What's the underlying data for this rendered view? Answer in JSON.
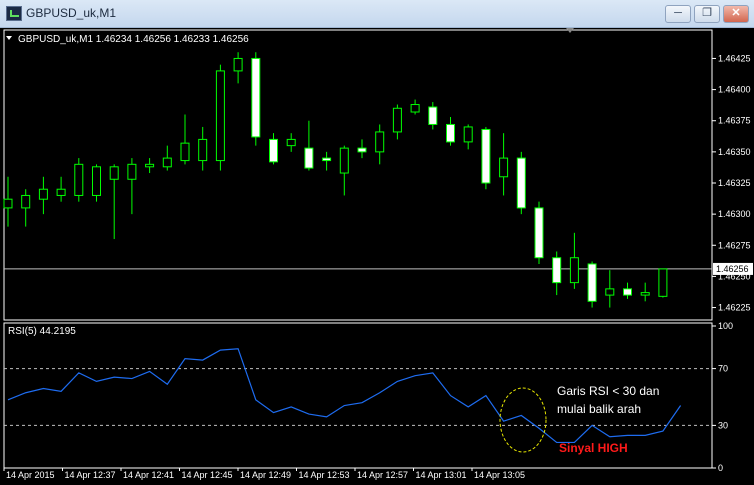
{
  "window": {
    "title": "GBPUSD_uk,M1",
    "minimize_icon": "minimize-icon",
    "restore_icon": "restore-icon",
    "close_icon": "close-icon"
  },
  "price_panel": {
    "header": "GBPUSD_uk,M1  1.46234 1.46256 1.46233 1.46256",
    "current_price": "1.46256"
  },
  "rsi_panel": {
    "header": "RSI(5) 44.2195"
  },
  "annotations": {
    "text_line1": "Garis RSI < 30 dan",
    "text_line2": "mulai balik arah",
    "signal": "Sinyal HIGH",
    "signal_color": "#ff1a1a"
  },
  "colors": {
    "background": "#000000",
    "candle_outline": "#00ff00",
    "bull_fill": "#000000",
    "bear_fill": "#ffffff",
    "rsi_line": "#1e6cf0",
    "axis_text": "#ffffff",
    "ellipse": "#e6e600"
  },
  "chart_data": [
    {
      "type": "candlestick",
      "title": "GBPUSD_uk,M1",
      "y_ticks": [
        "1.46425",
        "1.46400",
        "1.46375",
        "1.46350",
        "1.46325",
        "1.46300",
        "1.46275",
        "1.46250",
        "1.46225"
      ],
      "ylim": [
        1.46215,
        1.46435
      ],
      "current_price": 1.46256,
      "x_ticks": [
        "14 Apr 2015",
        "14 Apr 12:37",
        "14 Apr 12:41",
        "14 Apr 12:45",
        "14 Apr 12:49",
        "14 Apr 12:53",
        "14 Apr 12:57",
        "14 Apr 13:01",
        "14 Apr 13:05"
      ],
      "candles": [
        {
          "o": 1.46305,
          "h": 1.4633,
          "l": 1.4629,
          "c": 1.46312
        },
        {
          "o": 1.46305,
          "h": 1.4632,
          "l": 1.4629,
          "c": 1.46315
        },
        {
          "o": 1.46312,
          "h": 1.4633,
          "l": 1.463,
          "c": 1.4632
        },
        {
          "o": 1.46315,
          "h": 1.4633,
          "l": 1.4631,
          "c": 1.4632
        },
        {
          "o": 1.46315,
          "h": 1.46345,
          "l": 1.4631,
          "c": 1.4634
        },
        {
          "o": 1.46315,
          "h": 1.4634,
          "l": 1.4631,
          "c": 1.46338
        },
        {
          "o": 1.46328,
          "h": 1.4634,
          "l": 1.4628,
          "c": 1.46338
        },
        {
          "o": 1.46328,
          "h": 1.46345,
          "l": 1.463,
          "c": 1.4634
        },
        {
          "o": 1.46338,
          "h": 1.46345,
          "l": 1.46333,
          "c": 1.4634
        },
        {
          "o": 1.46338,
          "h": 1.46355,
          "l": 1.46335,
          "c": 1.46345
        },
        {
          "o": 1.46343,
          "h": 1.4638,
          "l": 1.4634,
          "c": 1.46357
        },
        {
          "o": 1.46343,
          "h": 1.4637,
          "l": 1.46335,
          "c": 1.4636
        },
        {
          "o": 1.46343,
          "h": 1.4642,
          "l": 1.46335,
          "c": 1.46415
        },
        {
          "o": 1.46415,
          "h": 1.4643,
          "l": 1.46405,
          "c": 1.46425
        },
        {
          "o": 1.46425,
          "h": 1.4643,
          "l": 1.46355,
          "c": 1.46362
        },
        {
          "o": 1.4636,
          "h": 1.46365,
          "l": 1.4634,
          "c": 1.46342
        },
        {
          "o": 1.46355,
          "h": 1.46365,
          "l": 1.4635,
          "c": 1.4636
        },
        {
          "o": 1.46353,
          "h": 1.46375,
          "l": 1.46335,
          "c": 1.46337
        },
        {
          "o": 1.46345,
          "h": 1.4635,
          "l": 1.46335,
          "c": 1.46343
        },
        {
          "o": 1.46333,
          "h": 1.46355,
          "l": 1.46315,
          "c": 1.46353
        },
        {
          "o": 1.46353,
          "h": 1.4636,
          "l": 1.46345,
          "c": 1.4635
        },
        {
          "o": 1.4635,
          "h": 1.46372,
          "l": 1.4634,
          "c": 1.46366
        },
        {
          "o": 1.46366,
          "h": 1.46388,
          "l": 1.4636,
          "c": 1.46385
        },
        {
          "o": 1.46382,
          "h": 1.46392,
          "l": 1.4638,
          "c": 1.46388
        },
        {
          "o": 1.46386,
          "h": 1.4639,
          "l": 1.46368,
          "c": 1.46372
        },
        {
          "o": 1.46372,
          "h": 1.46378,
          "l": 1.46355,
          "c": 1.46358
        },
        {
          "o": 1.46358,
          "h": 1.46372,
          "l": 1.46352,
          "c": 1.4637
        },
        {
          "o": 1.46368,
          "h": 1.4637,
          "l": 1.4632,
          "c": 1.46325
        },
        {
          "o": 1.4633,
          "h": 1.46365,
          "l": 1.46315,
          "c": 1.46345
        },
        {
          "o": 1.46345,
          "h": 1.4635,
          "l": 1.463,
          "c": 1.46305
        },
        {
          "o": 1.46305,
          "h": 1.4631,
          "l": 1.4626,
          "c": 1.46265
        },
        {
          "o": 1.46265,
          "h": 1.4627,
          "l": 1.46235,
          "c": 1.46245
        },
        {
          "o": 1.46245,
          "h": 1.46285,
          "l": 1.4624,
          "c": 1.46265
        },
        {
          "o": 1.4626,
          "h": 1.46262,
          "l": 1.46225,
          "c": 1.4623
        },
        {
          "o": 1.46235,
          "h": 1.46255,
          "l": 1.46225,
          "c": 1.4624
        },
        {
          "o": 1.4624,
          "h": 1.46245,
          "l": 1.46232,
          "c": 1.46235
        },
        {
          "o": 1.46235,
          "h": 1.46245,
          "l": 1.4623,
          "c": 1.46237
        },
        {
          "o": 1.46234,
          "h": 1.46256,
          "l": 1.46233,
          "c": 1.46256
        }
      ]
    },
    {
      "type": "line",
      "title": "RSI(5) 44.2195",
      "y_ticks": [
        "100",
        "70",
        "30",
        "0"
      ],
      "levels": [
        70,
        30
      ],
      "ylim": [
        0,
        100
      ],
      "values": [
        48,
        53,
        56,
        54,
        67,
        61,
        64,
        63,
        68,
        59,
        77,
        76,
        83,
        84,
        48,
        39,
        43,
        38,
        36,
        44,
        46,
        53,
        61,
        65,
        67,
        51,
        43,
        51,
        33,
        37,
        28,
        18,
        18,
        30,
        22,
        23,
        23,
        26,
        44
      ]
    }
  ]
}
